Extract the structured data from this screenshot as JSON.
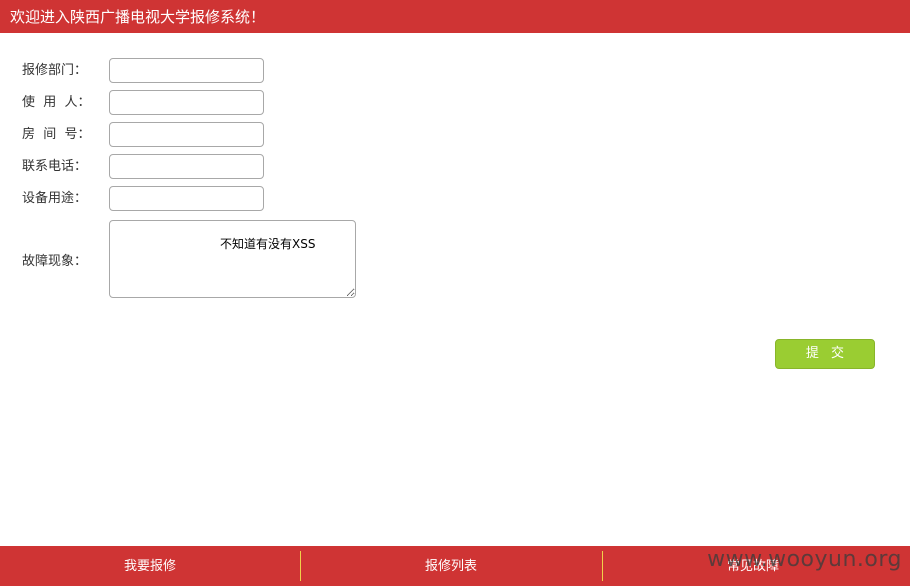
{
  "header": {
    "title": "欢迎进入陕西广播电视大学报修系统！"
  },
  "form": {
    "fields": [
      {
        "label": "报修部门：",
        "value": "",
        "placeholder": ""
      },
      {
        "label": "使  用  人：",
        "value": "",
        "placeholder": ""
      },
      {
        "label": "房  间  号：",
        "value": "",
        "placeholder": ""
      },
      {
        "label": "联系电话：",
        "value": "",
        "placeholder": ""
      },
      {
        "label": "设备用途：",
        "value": "",
        "placeholder": ""
      }
    ],
    "fault": {
      "label": "故障现象：",
      "value": "不知道有没有XSS"
    },
    "submit_label": "提 交"
  },
  "footer": {
    "tabs": [
      {
        "label": "我要报修"
      },
      {
        "label": "报修列表"
      },
      {
        "label": "常见故障"
      }
    ]
  },
  "watermark": "www.wooyun.org",
  "colors": {
    "brand_red": "#cf3434",
    "submit_green": "#9acd32",
    "divider_yellow": "#f0d04a"
  }
}
